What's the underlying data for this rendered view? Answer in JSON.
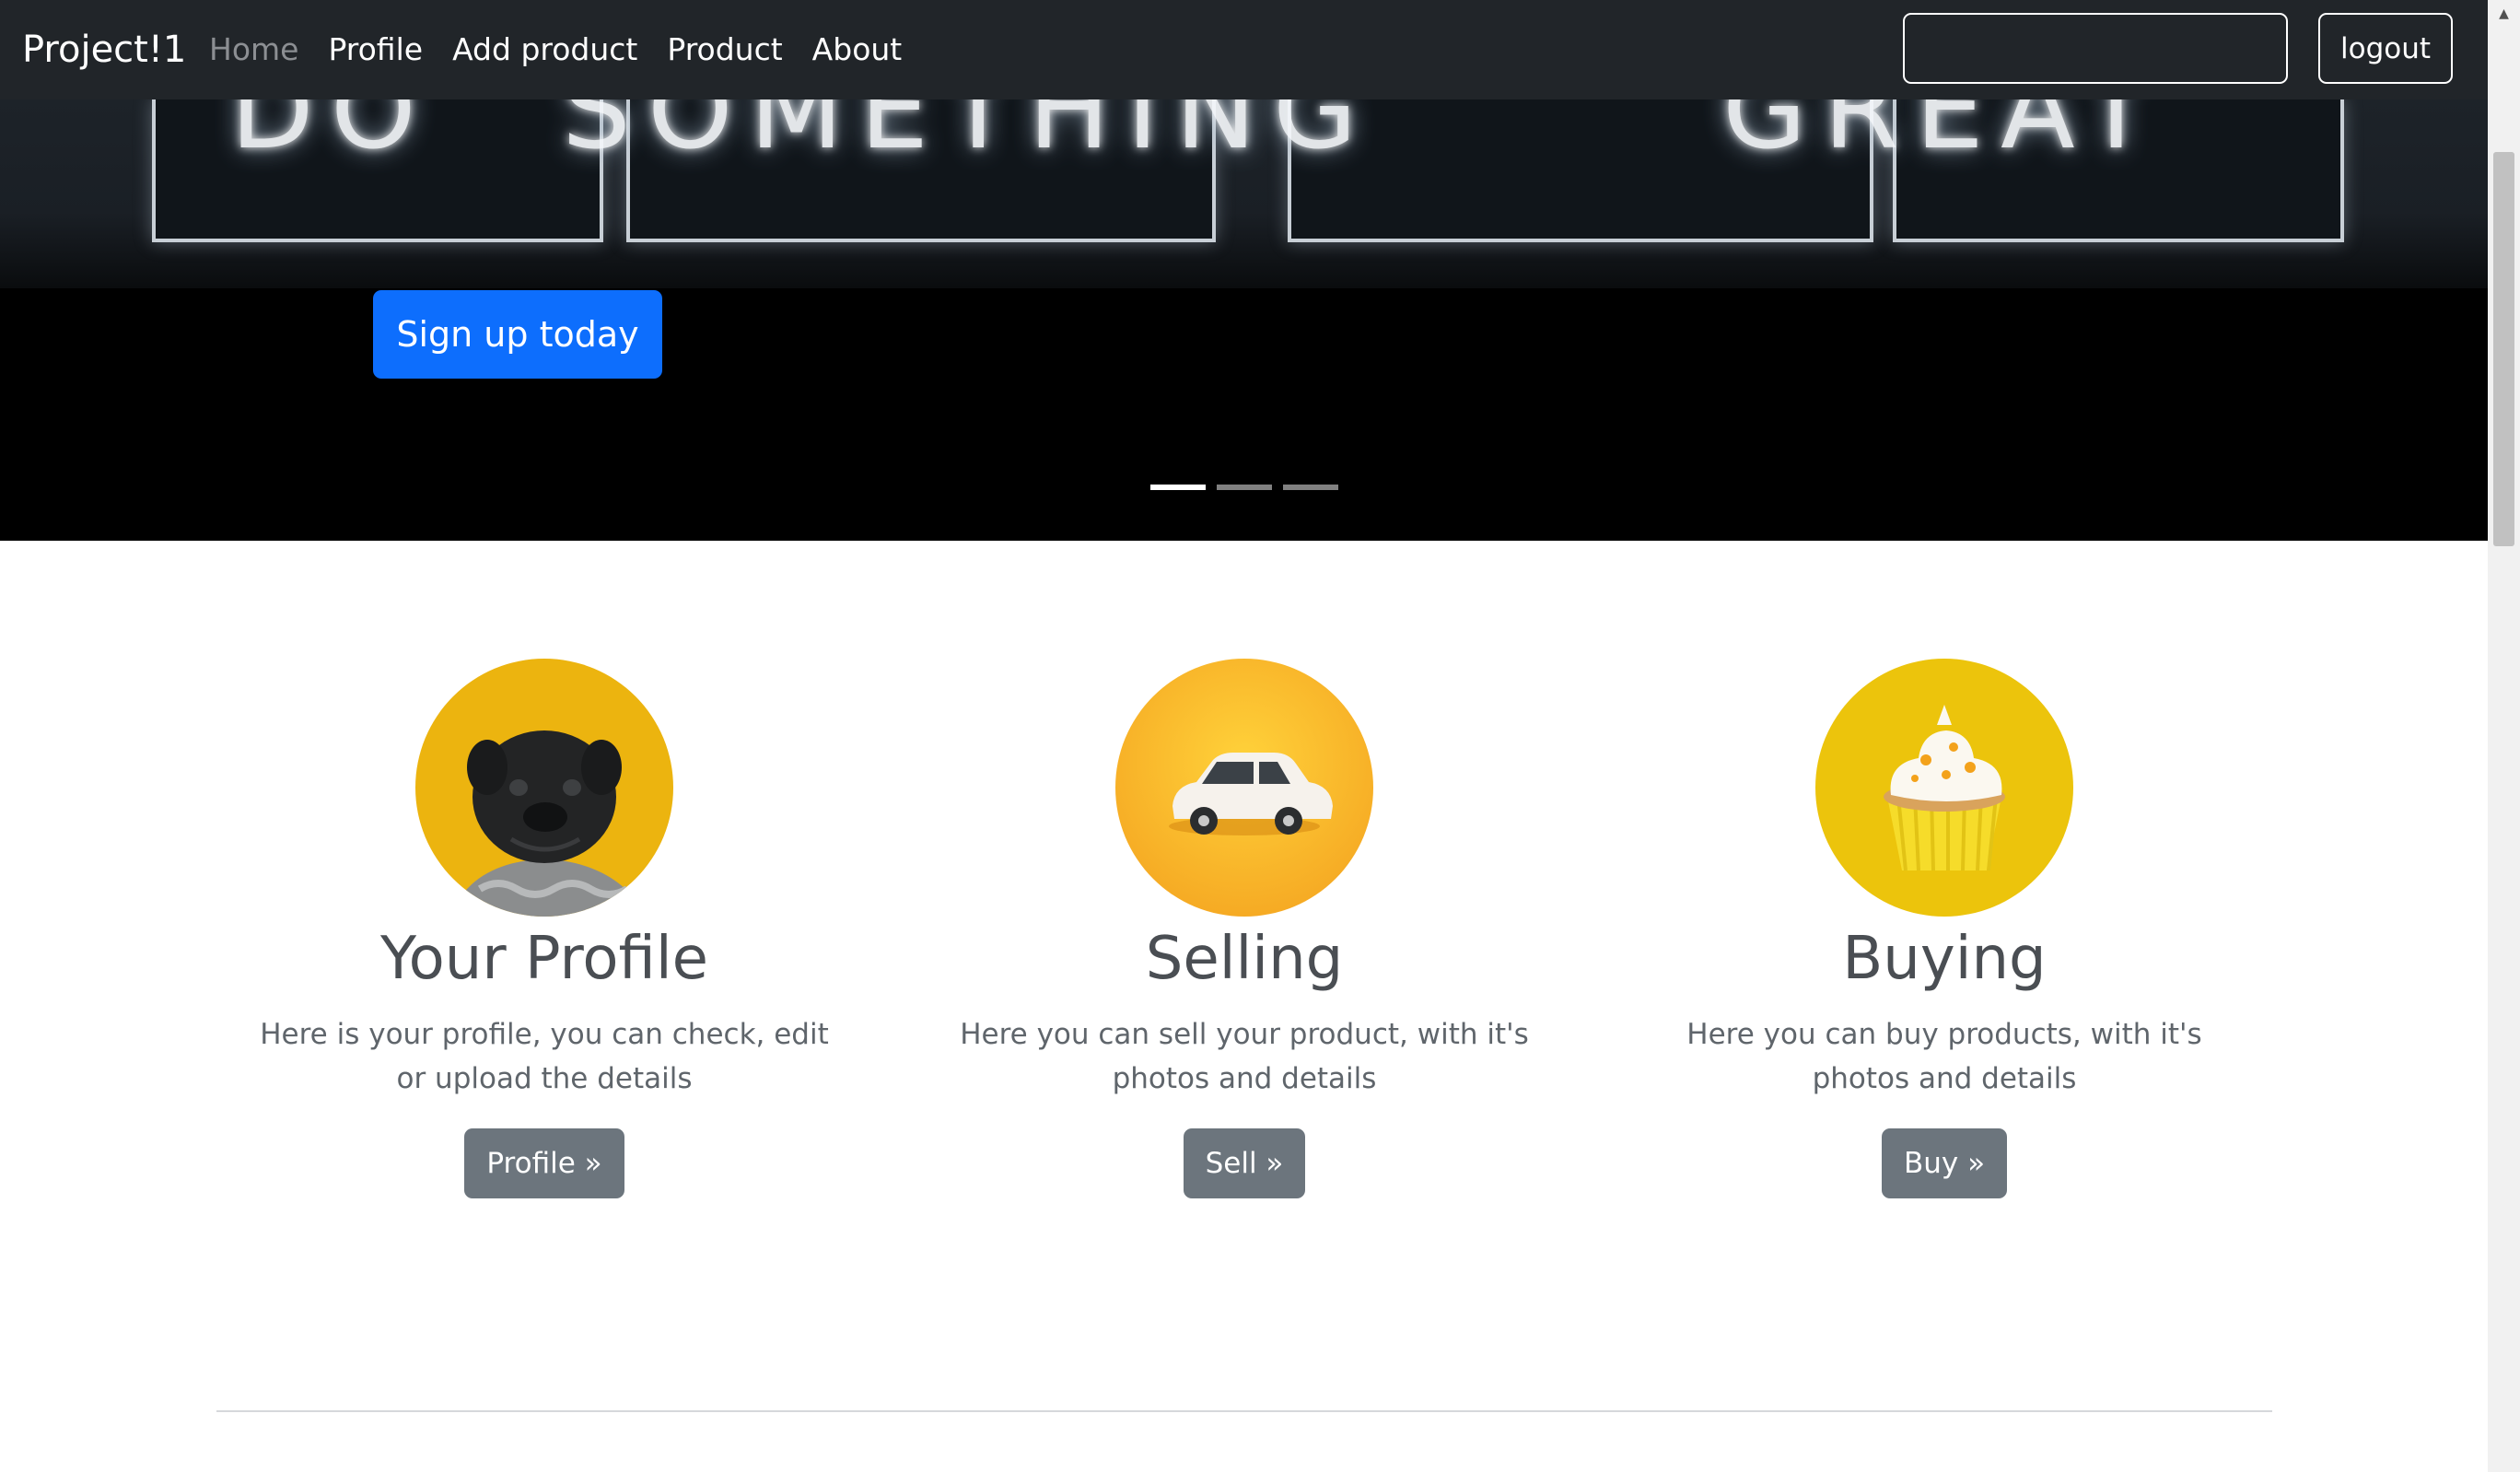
{
  "navbar": {
    "brand": "Project!1",
    "links": [
      {
        "label": "Home",
        "active": true
      },
      {
        "label": "Profile",
        "active": false
      },
      {
        "label": "Add product",
        "active": false
      },
      {
        "label": "Product",
        "active": false
      },
      {
        "label": "About",
        "active": false
      }
    ],
    "search": {
      "value": "",
      "placeholder": ""
    },
    "logout_label": "logout"
  },
  "hero": {
    "signup_label": "Sign up today",
    "slide_count": 3,
    "active_slide": 1
  },
  "columns": [
    {
      "image": "pug-dog-photo",
      "heading": "Your Profile",
      "text": "Here is your profile, you can check, edit or upload the details",
      "button": "Profile »"
    },
    {
      "image": "toy-car-photo",
      "heading": "Selling",
      "text": "Here you can sell your product, with it's photos and details",
      "button": "Sell »"
    },
    {
      "image": "cupcake-photo",
      "heading": "Buying",
      "text": "Here you can buy products, with it's photos and details",
      "button": "Buy »"
    }
  ],
  "colors": {
    "navbar_bg": "#212529",
    "primary": "#0d6efd",
    "secondary": "#6c757d",
    "nav_active": "#8c8f93"
  }
}
